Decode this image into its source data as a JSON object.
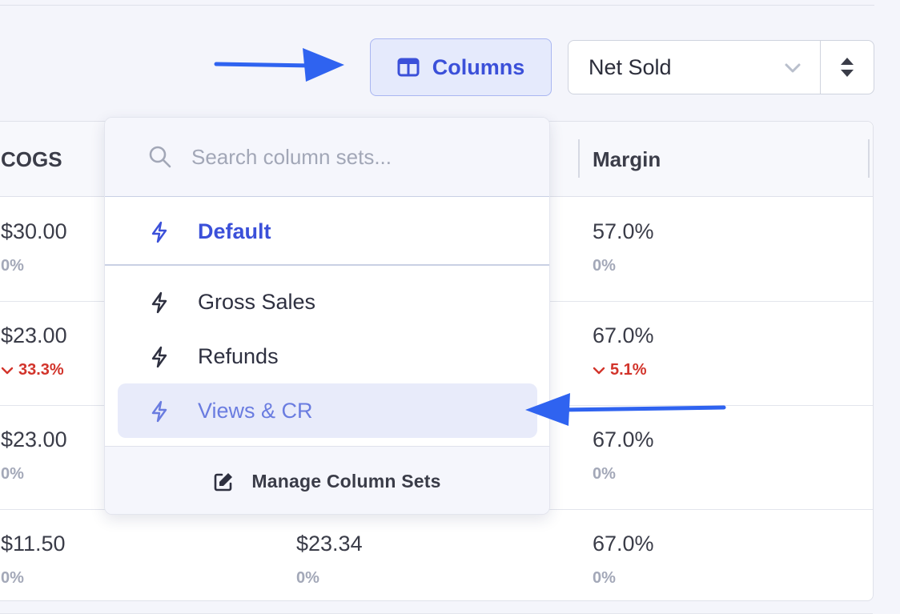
{
  "toolbar": {
    "columns_label": "Columns",
    "sort_value": "Net Sold"
  },
  "table": {
    "headers": [
      "COGS",
      "Margin"
    ],
    "rows": [
      {
        "cogs": "$30.00",
        "cogs_change": "0%",
        "cogs_trend": "neutral",
        "mid": "",
        "mid_change": "",
        "margin": "57.0%",
        "margin_change": "0%",
        "margin_trend": "neutral"
      },
      {
        "cogs": "$23.00",
        "cogs_change": "33.3%",
        "cogs_trend": "down",
        "mid": "",
        "mid_change": "",
        "margin": "67.0%",
        "margin_change": "5.1%",
        "margin_trend": "down"
      },
      {
        "cogs": "$23.00",
        "cogs_change": "0%",
        "cogs_trend": "neutral",
        "mid": "",
        "mid_change": "",
        "margin": "67.0%",
        "margin_change": "0%",
        "margin_trend": "neutral"
      },
      {
        "cogs": "$11.50",
        "cogs_change": "0%",
        "cogs_trend": "neutral",
        "mid": "$23.34",
        "mid_change": "0%",
        "margin": "67.0%",
        "margin_change": "0%",
        "margin_trend": "neutral"
      }
    ]
  },
  "dropdown": {
    "search_placeholder": "Search column sets...",
    "default_item": "Default",
    "items": [
      "Gross Sales",
      "Refunds",
      "Views & CR"
    ],
    "footer_label": "Manage Column Sets",
    "item_icon": "bolt-icon",
    "footer_icon": "edit-icon"
  },
  "colors": {
    "accent": "#3b50d9",
    "annotation_arrow": "#2f63f0",
    "negative": "#d2342b"
  }
}
